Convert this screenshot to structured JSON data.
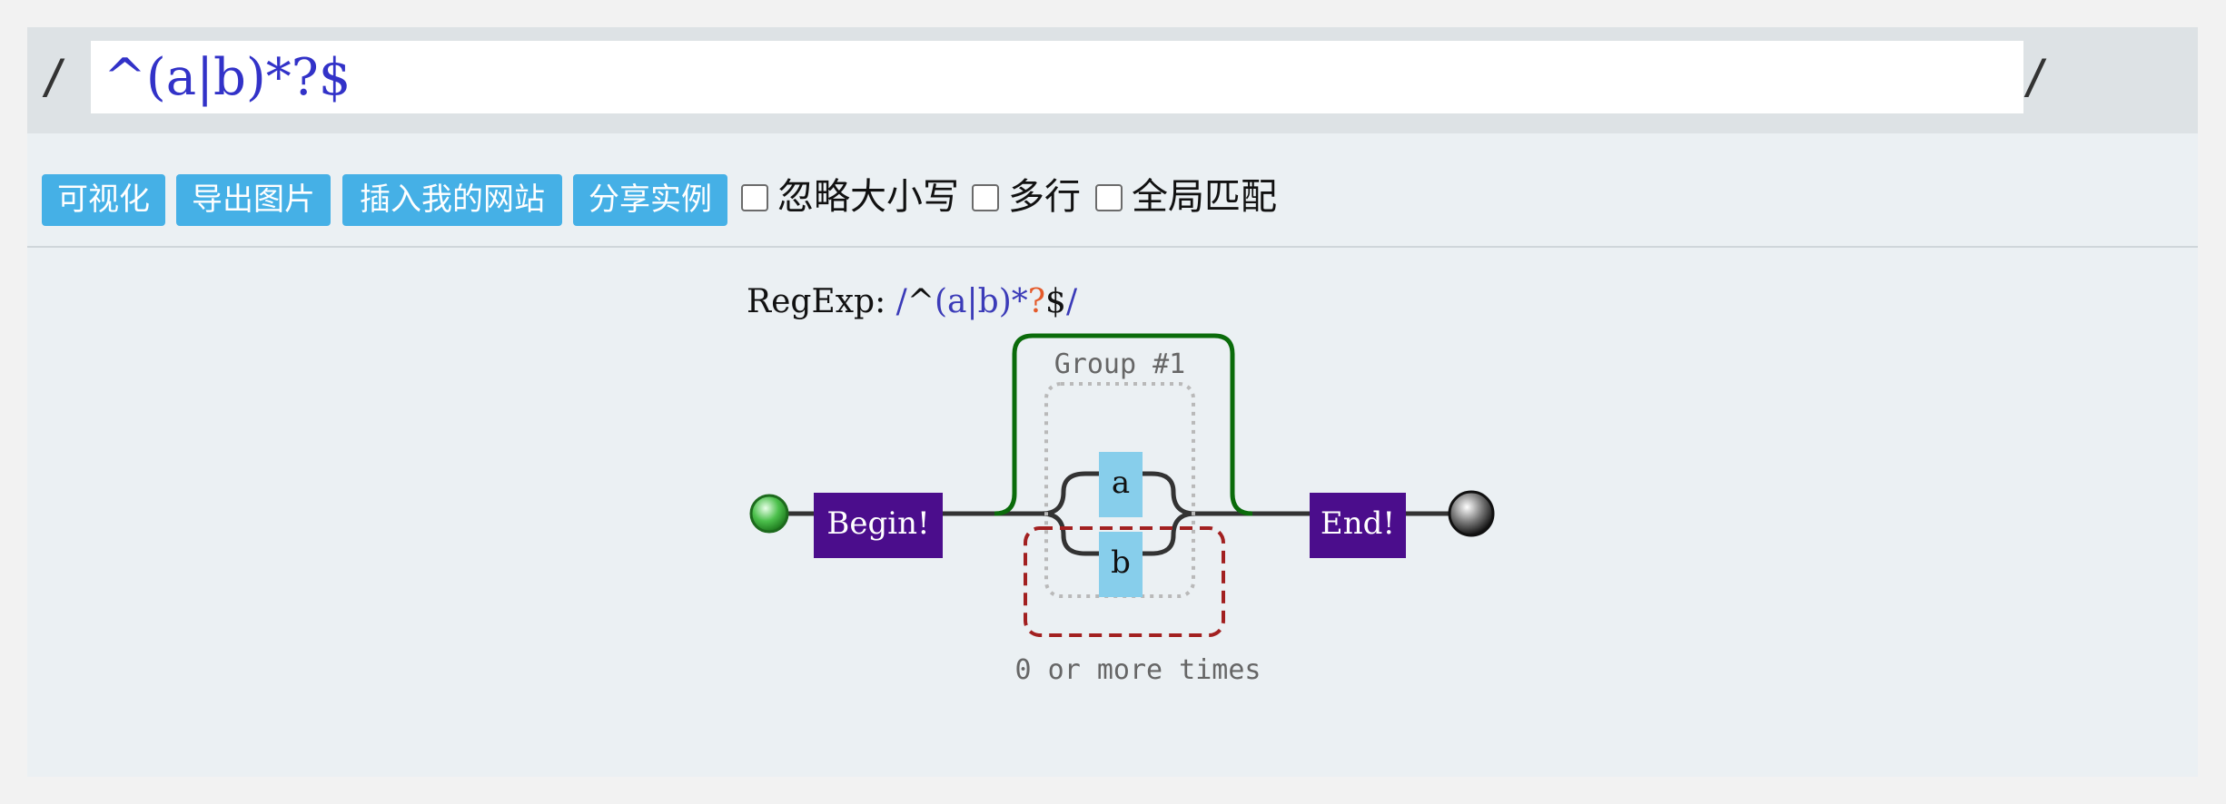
{
  "input": {
    "left_slash": "/",
    "right_slash": "/",
    "pattern": "^(a|b)*?$"
  },
  "toolbar": {
    "buttons": [
      "可视化",
      "导出图片",
      "插入我的网站",
      "分享实例"
    ],
    "options": [
      {
        "label": "忽略大小写",
        "checked": false
      },
      {
        "label": "多行",
        "checked": false
      },
      {
        "label": "全局匹配",
        "checked": false
      }
    ]
  },
  "diagram": {
    "caption_prefix": "RegExp:",
    "caption_parts": [
      {
        "text": "/",
        "color": "#3b3bb8"
      },
      {
        "text": "^",
        "color": "#111111"
      },
      {
        "text": "(",
        "color": "#3b3bb8"
      },
      {
        "text": "a",
        "color": "#3b3bb8"
      },
      {
        "text": "|",
        "color": "#3b3bb8"
      },
      {
        "text": "b",
        "color": "#3b3bb8"
      },
      {
        "text": ")",
        "color": "#3b3bb8"
      },
      {
        "text": "*",
        "color": "#3b3bb8"
      },
      {
        "text": "?",
        "color": "#e45a2a"
      },
      {
        "text": "$",
        "color": "#111111"
      },
      {
        "text": "/",
        "color": "#3b3bb8"
      }
    ],
    "begin_label": "Begin!",
    "end_label": "End!",
    "group_label": "Group #1",
    "branch_a": "a",
    "branch_b": "b",
    "repeat_label": "0 or more times",
    "colors": {
      "anchor_box": "#4b0d8c",
      "char_box": "#87ceeb",
      "skip_path": "#0a6b0a",
      "repeat_path": "#a22020",
      "group_border": "#b9b9b9",
      "line": "#333333"
    }
  }
}
